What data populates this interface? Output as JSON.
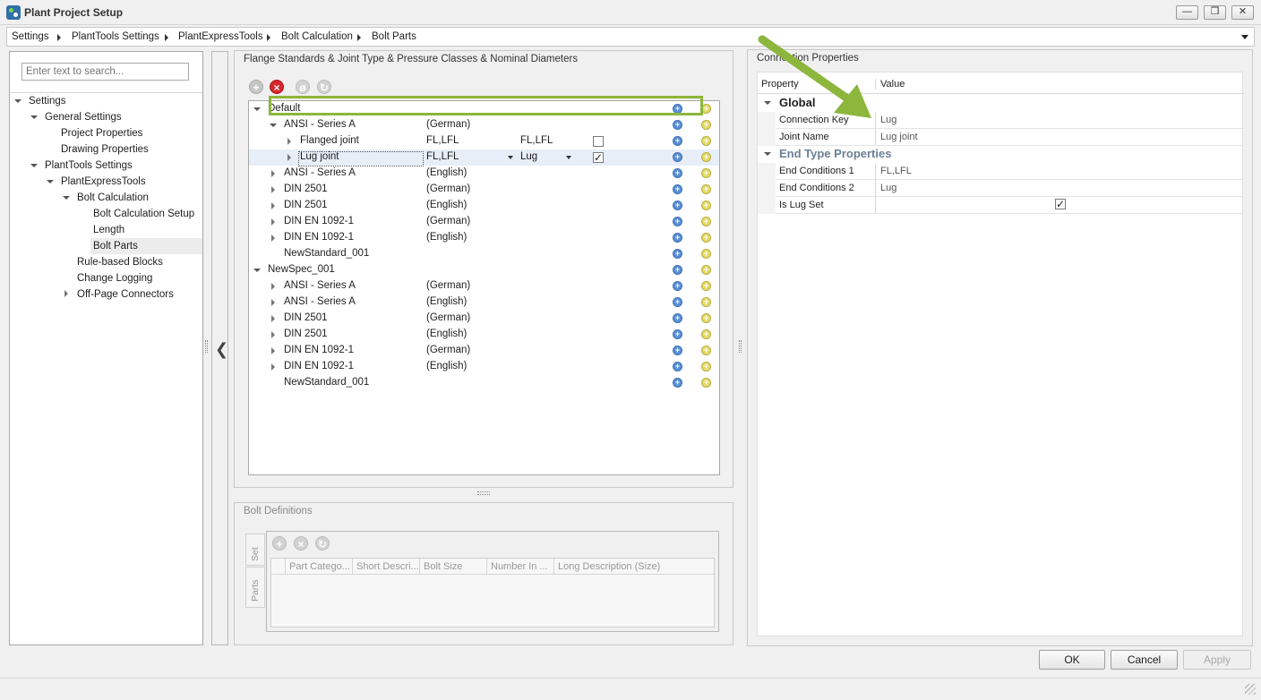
{
  "window": {
    "title": "Plant Project Setup",
    "minimize": "—",
    "maximize": "❐",
    "close": "✕"
  },
  "breadcrumb": [
    "Settings",
    "PlantTools Settings",
    "PlantExpressTools",
    "Bolt Calculation",
    "Bolt Parts"
  ],
  "search": {
    "placeholder": "Enter text to search..."
  },
  "settings_tree": [
    "Settings",
    "General Settings",
    "Project Properties",
    "Drawing Properties",
    "PlantTools Settings",
    "PlantExpressTools",
    "Bolt Calculation",
    "Bolt Calculation Setup",
    "Length",
    "Bolt Parts",
    "Rule-based Blocks",
    "Change Logging",
    "Off-Page Connectors"
  ],
  "collapse_glyph": "❮",
  "flange_panel": {
    "title": "Flange Standards & Joint Type & Pressure Classes & Nominal Diameters",
    "rows": [
      {
        "name": "Default",
        "lang": "",
        "end1": "",
        "end2": "",
        "check": ""
      },
      {
        "name": "ANSI - Series A",
        "lang": "(German)",
        "end1": "",
        "end2": "",
        "check": ""
      },
      {
        "name": "Flanged joint",
        "lang": "FL,LFL",
        "end1": "FL,LFL",
        "end2": "",
        "check": ""
      },
      {
        "name": "Lug joint",
        "lang": "FL,LFL",
        "end1": "Lug",
        "end2": "",
        "check": "✓"
      },
      {
        "name": "ANSI - Series A",
        "lang": "(English)"
      },
      {
        "name": "DIN 2501",
        "lang": "(German)"
      },
      {
        "name": "DIN 2501",
        "lang": "(English)"
      },
      {
        "name": "DIN EN 1092-1",
        "lang": "(German)"
      },
      {
        "name": "DIN EN 1092-1",
        "lang": "(English)"
      },
      {
        "name": "NewStandard_001",
        "lang": ""
      },
      {
        "name": "NewSpec_001",
        "lang": ""
      },
      {
        "name": "ANSI - Series A",
        "lang": "(German)"
      },
      {
        "name": "ANSI - Series A",
        "lang": "(English)"
      },
      {
        "name": "DIN 2501",
        "lang": "(German)"
      },
      {
        "name": "DIN 2501",
        "lang": "(English)"
      },
      {
        "name": "DIN EN 1092-1",
        "lang": "(German)"
      },
      {
        "name": "DIN EN 1092-1",
        "lang": "(English)"
      },
      {
        "name": "NewStandard_001",
        "lang": ""
      }
    ]
  },
  "bolt_panel": {
    "title": "Bolt Definitions",
    "tabs": [
      "Set",
      "Parts"
    ],
    "columns": [
      "Part Catego...",
      "Short Descri...",
      "Bolt Size",
      "Number In ...",
      "Long Description (Size)"
    ]
  },
  "props_panel": {
    "title": "Connection Properties",
    "header_property": "Property",
    "header_value": "Value",
    "cat_global": "Global",
    "cat_endtype": "End Type Properties",
    "connection_key_label": "Connection Key",
    "connection_key_value": "Lug",
    "joint_name_label": "Joint Name",
    "joint_name_value": "Lug joint",
    "end1_label": "End Conditions 1",
    "end1_value": "FL,LFL",
    "end2_label": "End Conditions 2",
    "end2_value": "Lug",
    "lugset_label": "Is Lug Set",
    "lugset_value": "✓"
  },
  "buttons": {
    "ok": "OK",
    "cancel": "Cancel",
    "apply": "Apply"
  },
  "colors": {
    "highlight_green": "#8db63c",
    "delete_red": "#d7262c",
    "add_blue": "#5b8fd3",
    "add_yellow": "#e6db6a"
  }
}
